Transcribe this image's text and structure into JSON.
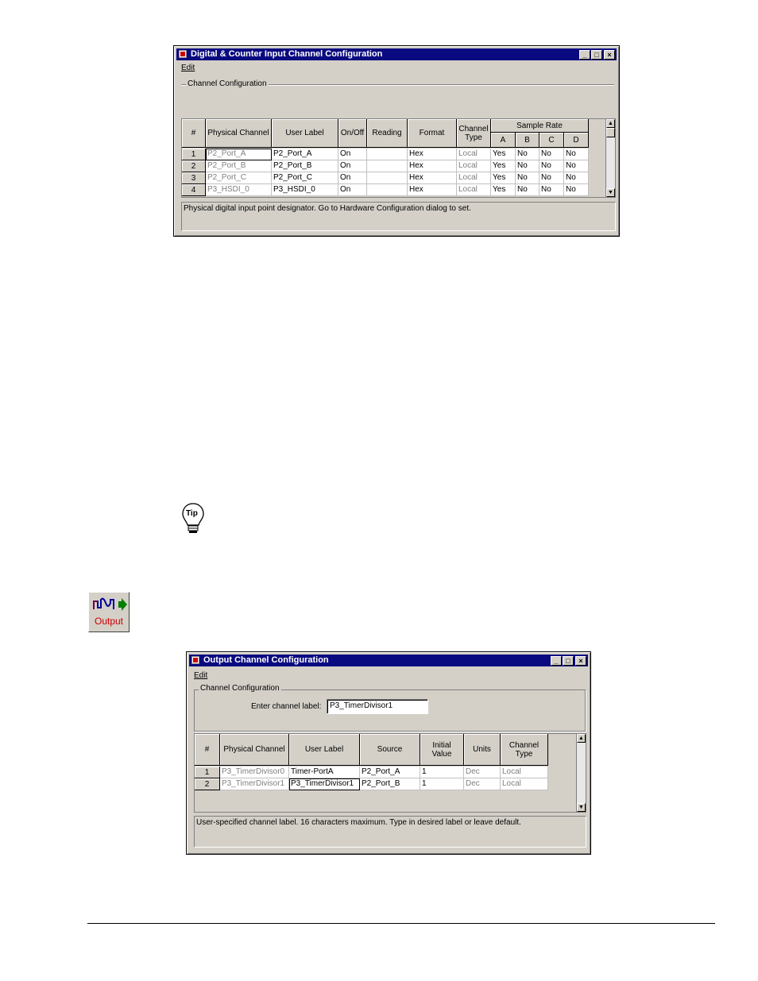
{
  "input_window": {
    "title": "Digital & Counter Input Channel Configuration",
    "menu_edit": "Edit",
    "group_label": "Channel Configuration",
    "headers": {
      "num": "#",
      "physical": "Physical Channel",
      "label": "User Label",
      "onoff": "On/Off",
      "reading": "Reading",
      "format": "Format",
      "chtype": "Channel Type",
      "sample_rate": "Sample Rate",
      "a": "A",
      "b": "B",
      "c": "C",
      "d": "D"
    },
    "rows": [
      {
        "num": "1",
        "physical": "P2_Port_A",
        "label": "P2_Port_A",
        "onoff": "On",
        "reading": "",
        "format": "Hex",
        "chtype": "Local",
        "a": "Yes",
        "b": "No",
        "c": "No",
        "d": "No"
      },
      {
        "num": "2",
        "physical": "P2_Port_B",
        "label": "P2_Port_B",
        "onoff": "On",
        "reading": "",
        "format": "Hex",
        "chtype": "Local",
        "a": "Yes",
        "b": "No",
        "c": "No",
        "d": "No"
      },
      {
        "num": "3",
        "physical": "P2_Port_C",
        "label": "P2_Port_C",
        "onoff": "On",
        "reading": "",
        "format": "Hex",
        "chtype": "Local",
        "a": "Yes",
        "b": "No",
        "c": "No",
        "d": "No"
      },
      {
        "num": "4",
        "physical": "P3_HSDI_0",
        "label": "P3_HSDI_0",
        "onoff": "On",
        "reading": "",
        "format": "Hex",
        "chtype": "Local",
        "a": "Yes",
        "b": "No",
        "c": "No",
        "d": "No"
      }
    ],
    "status": "Physical digital input point designator. Go to Hardware Configuration dialog to set."
  },
  "tip_icon_text": "Tip",
  "output_button_label": "Output",
  "output_window": {
    "title": "Output Channel Configuration",
    "menu_edit": "Edit",
    "group_label": "Channel Configuration",
    "enter_label": "Enter channel label:",
    "channel_label_value": "P3_TimerDivisor1",
    "headers": {
      "num": "#",
      "physical": "Physical Channel",
      "label": "User Label",
      "source": "Source",
      "initial": "Initial Value",
      "units": "Units",
      "chtype": "Channel Type"
    },
    "rows": [
      {
        "num": "1",
        "physical": "P3_TimerDivisor0",
        "label": "Timer-PortA",
        "source": "P2_Port_A",
        "initial": "1",
        "units": "Dec",
        "chtype": "Local"
      },
      {
        "num": "2",
        "physical": "P3_TimerDivisor1",
        "label": "P3_TimerDivisor1",
        "source": "P2_Port_B",
        "initial": "1",
        "units": "Dec",
        "chtype": "Local"
      }
    ],
    "status": "User-specified channel label. 16 characters maximum. Type in desired label or leave default."
  }
}
